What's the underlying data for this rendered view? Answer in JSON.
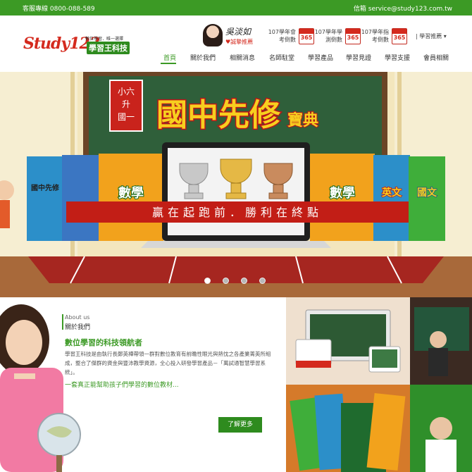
{
  "topbar": {
    "hotline": "客服專線 0800-088-589",
    "email": "信箱 service@study123.com.tw"
  },
  "header": {
    "logo_brand": "Study123",
    "logo_tagline": "數位學習．唯一選擇",
    "logo_sub": "學習王科技",
    "endorse_signature": "吳淡如",
    "endorse_label": "♥誠摯推薦",
    "countdowns": [
      {
        "label": "107學年會考倒數",
        "value": "365"
      },
      {
        "label": "107學年學測倒數",
        "value": "365"
      },
      {
        "label": "107學年指考倒數",
        "value": "365"
      }
    ],
    "learning_recommend": "| 學習推薦 ▾"
  },
  "nav": {
    "items": [
      "首頁",
      "關於我們",
      "相關消息",
      "名師駐堂",
      "學習產品",
      "學習見證",
      "學習支援",
      "會員相關"
    ],
    "active_index": 0
  },
  "hero": {
    "badge_line1": "小六",
    "badge_line2": "升",
    "badge_line3": "國一",
    "title": "國中先修",
    "title_suffix": "寶典",
    "banner": "贏在起跑前．勝利在終點",
    "book_labels": [
      "國中先修",
      "數學",
      "數學",
      "英文",
      "國文"
    ],
    "slide_count": 4,
    "active_slide": 0
  },
  "about": {
    "english": "About us",
    "chinese": "關於我們",
    "headline": "數位學習的科技領航者",
    "body": "學習王科技是由執行長鄭英樺帶領一群對數位教育有前瞻性眼光與熱忱之各產業菁英所組成，整合了傑群的資金與豐沛教學資源，全心投入研發學習產品－「萬試通智慧學習系統」。",
    "tagline": "一套真正能幫助孩子們學習的數位教材...",
    "more_button": "了解更多"
  },
  "colors": {
    "brand_green": "#3c9a25",
    "brand_red": "#d42a1e"
  }
}
